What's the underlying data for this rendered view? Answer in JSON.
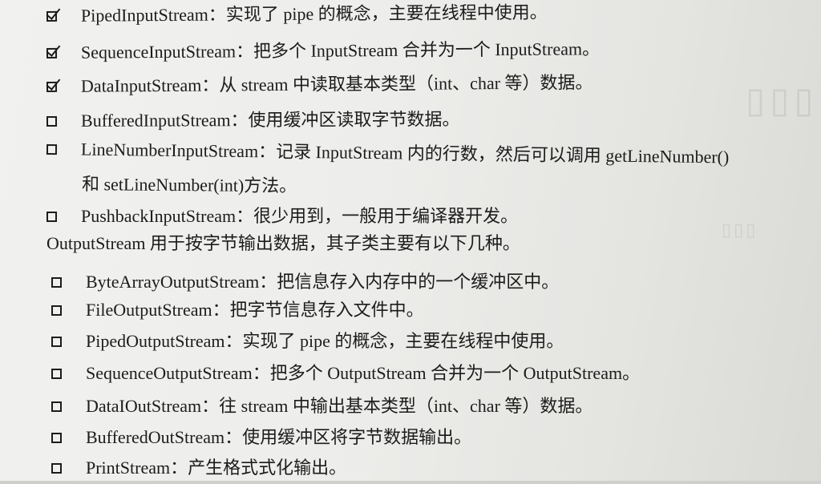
{
  "items": [
    {
      "text": "PipedInputStream：实现了 pipe 的概念，主要在线程中使用。",
      "checked": true
    },
    {
      "text": "SequenceInputStream：把多个 InputStream 合并为一个 InputStream。",
      "checked": true
    },
    {
      "text": "DataInputStream：从 stream 中读取基本类型（int、char 等）数据。",
      "checked": true
    },
    {
      "text": "BufferedInputStream：使用缓冲区读取字节数据。",
      "checked": false
    },
    {
      "text": "LineNumberInputStream：记录 InputStream 内的行数，然后可以调用 getLineNumber()",
      "checked": false
    },
    {
      "text": "和 setLineNumber(int)方法。",
      "continuation": true
    },
    {
      "text": "PushbackInputStream：很少用到，一般用于编译器开发。",
      "checked": false
    },
    {
      "text": "OutputStream 用于按字节输出数据，其子类主要有以下几种。",
      "paragraph": true
    },
    {
      "text": "ByteArrayOutputStream：把信息存入内存中的一个缓冲区中。",
      "checked": false
    },
    {
      "text": "FileOutputStream：把字节信息存入文件中。",
      "checked": false
    },
    {
      "text": "PipedOutputStream：实现了 pipe 的概念，主要在线程中使用。",
      "checked": false
    },
    {
      "text": "SequenceOutputStream：把多个 OutputStream 合并为一个 OutputStream。",
      "checked": false
    },
    {
      "text": "DataIOutStream：往 stream 中输出基本类型（int、char 等）数据。",
      "checked": false
    },
    {
      "text": "BufferedOutStream：使用缓冲区将字节数据输出。",
      "checked": false
    },
    {
      "text": "PrintStream：产生格式式化输出。",
      "checked": false
    }
  ]
}
